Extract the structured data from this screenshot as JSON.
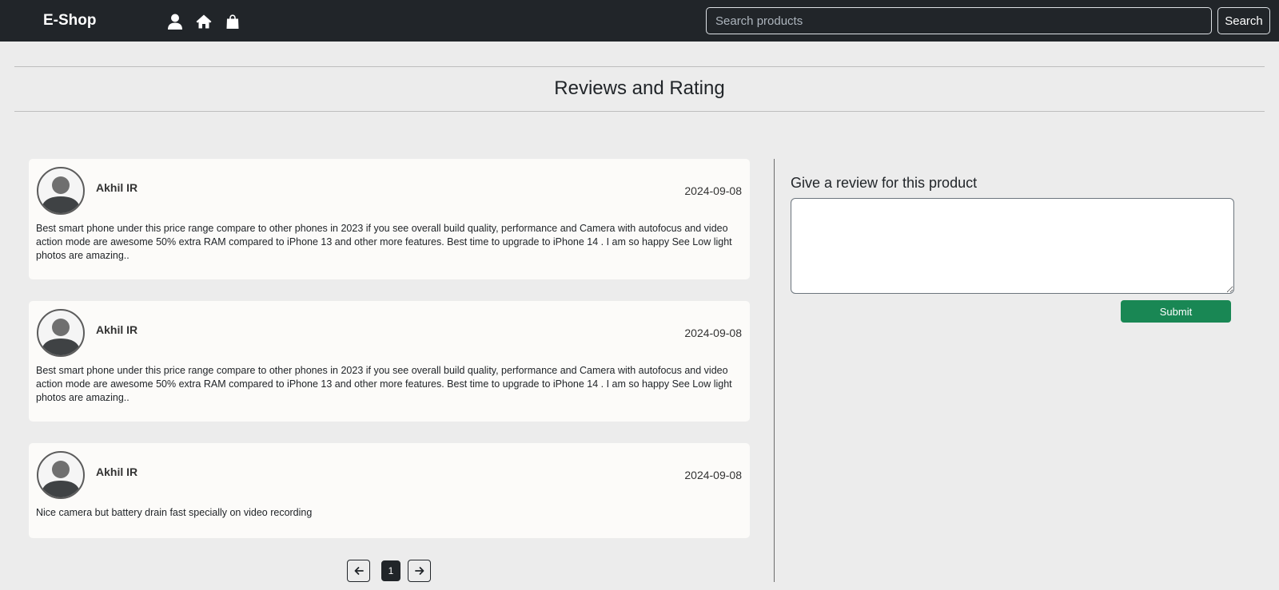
{
  "navbar": {
    "brand": "E-Shop",
    "icons": [
      "user-icon",
      "home-icon",
      "shopping-bag-icon"
    ],
    "search_placeholder": "Search products",
    "search_value": "",
    "search_button": "Search"
  },
  "page": {
    "title": "Reviews and Rating"
  },
  "reviews": [
    {
      "name": "Akhil IR",
      "date": "2024-09-08",
      "text": "Best smart phone under this price range compare to other phones in 2023 if you see overall build quality, performance and Camera with autofocus and video action mode are awesome 50% extra RAM compared to iPhone 13 and other more features. Best time to upgrade to iPhone 14 . I am so happy See Low light photos are amazing.."
    },
    {
      "name": "Akhil IR",
      "date": "2024-09-08",
      "text": "Best smart phone under this price range compare to other phones in 2023 if you see overall build quality, performance and Camera with autofocus and video action mode are awesome 50% extra RAM compared to iPhone 13 and other more features. Best time to upgrade to iPhone 14 . I am so happy See Low light photos are amazing.."
    },
    {
      "name": "Akhil IR",
      "date": "2024-09-08",
      "text": "Nice camera but battery drain fast specially on video recording"
    }
  ],
  "pagination": {
    "current_page": "1"
  },
  "review_form": {
    "title": "Give a review for this product",
    "textarea_value": "",
    "submit_label": "Submit"
  },
  "colors": {
    "navbar_bg": "#212529",
    "page_bg": "#ececec",
    "card_bg": "#fcfbf9",
    "submit_green": "#198754"
  }
}
